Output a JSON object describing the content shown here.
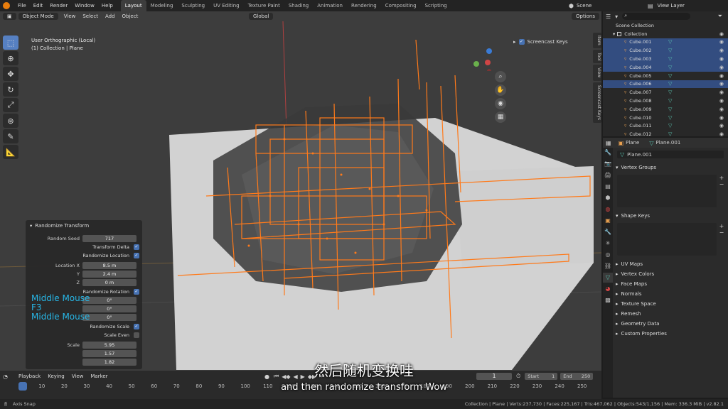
{
  "top_menu": [
    "File",
    "Edit",
    "Render",
    "Window",
    "Help"
  ],
  "workspaces": [
    "Layout",
    "Modeling",
    "Sculpting",
    "UV Editing",
    "Texture Paint",
    "Shading",
    "Animation",
    "Rendering",
    "Compositing",
    "Scripting"
  ],
  "active_workspace": "Layout",
  "scene_name": "Scene",
  "view_layer": "View Layer",
  "viewport": {
    "mode": "Object Mode",
    "menus": [
      "View",
      "Select",
      "Add",
      "Object"
    ],
    "orientation": "Global",
    "options_label": "Options",
    "info_line1": "User Orthographic (Local)",
    "info_line2": "(1) Collection | Plane"
  },
  "screencast_label": "Screencast Keys",
  "side_tabs": [
    "Item",
    "Tool",
    "View",
    "Screencast Keys"
  ],
  "randomize_panel": {
    "title": "Randomize Transform",
    "random_seed_label": "Random Seed",
    "random_seed": "717",
    "transform_delta": "Transform Delta",
    "randomize_location": "Randomize Location",
    "location_label": "Location X",
    "loc_x": "8.5 m",
    "y_label": "Y",
    "loc_y": "2.4 m",
    "z_label": "Z",
    "loc_z": "0 m",
    "randomize_rotation": "Randomize Rotation",
    "rot_x": "0°",
    "rot_y": "0°",
    "rot_z": "0°",
    "randomize_scale": "Randomize Scale",
    "scale_even": "Scale Even",
    "scale_label": "Scale",
    "scale_x": "5.95",
    "scale_y": "1.57",
    "scale_z": "1.82"
  },
  "screencast_keys": [
    "Middle Mouse",
    "F3",
    "Middle Mouse"
  ],
  "outliner": {
    "root": "Scene Collection",
    "collection": "Collection",
    "items": [
      {
        "name": "Cube.001",
        "selected": true
      },
      {
        "name": "Cube.002",
        "selected": true
      },
      {
        "name": "Cube.003",
        "selected": true
      },
      {
        "name": "Cube.004",
        "selected": true
      },
      {
        "name": "Cube.005",
        "selected": false
      },
      {
        "name": "Cube.006",
        "selected": true
      },
      {
        "name": "Cube.007",
        "selected": false
      },
      {
        "name": "Cube.008",
        "selected": false
      },
      {
        "name": "Cube.009",
        "selected": false
      },
      {
        "name": "Cube.010",
        "selected": false
      },
      {
        "name": "Cube.011",
        "selected": false
      },
      {
        "name": "Cube.012",
        "selected": false
      }
    ]
  },
  "properties": {
    "object": "Plane",
    "mesh": "Plane.001",
    "mesh_field": "Plane.001",
    "vertex_groups": "Vertex Groups",
    "shape_keys": "Shape Keys",
    "sections": [
      "UV Maps",
      "Vertex Colors",
      "Face Maps",
      "Normals",
      "Texture Space",
      "Remesh",
      "Geometry Data",
      "Custom Properties"
    ]
  },
  "timeline": {
    "menus": [
      "Playback",
      "Keying",
      "View",
      "Marker"
    ],
    "current_frame": "1",
    "start_label": "Start",
    "start": "1",
    "end_label": "End",
    "end": "250",
    "ticks": [
      "1",
      "10",
      "20",
      "30",
      "40",
      "50",
      "60",
      "70",
      "80",
      "90",
      "100",
      "110",
      "120",
      "130",
      "140",
      "150",
      "160",
      "170",
      "180",
      "190",
      "200",
      "210",
      "220",
      "230",
      "240",
      "250"
    ]
  },
  "status": {
    "left": "Axis Snap",
    "right": "Collection | Plane | Verts:237,730 | Faces:225,167 | Tris:467,062 | Objects:543/1,156 | Mem: 336.3 MiB | v2.82.1"
  },
  "subtitle_cn": "然后随机变换哇",
  "subtitle_en": "and then randomize transform Wow",
  "colors": {
    "selection_orange": "#ff7a1a",
    "accent_blue": "#4772b3",
    "screencast_cyan": "#27b6e6"
  }
}
